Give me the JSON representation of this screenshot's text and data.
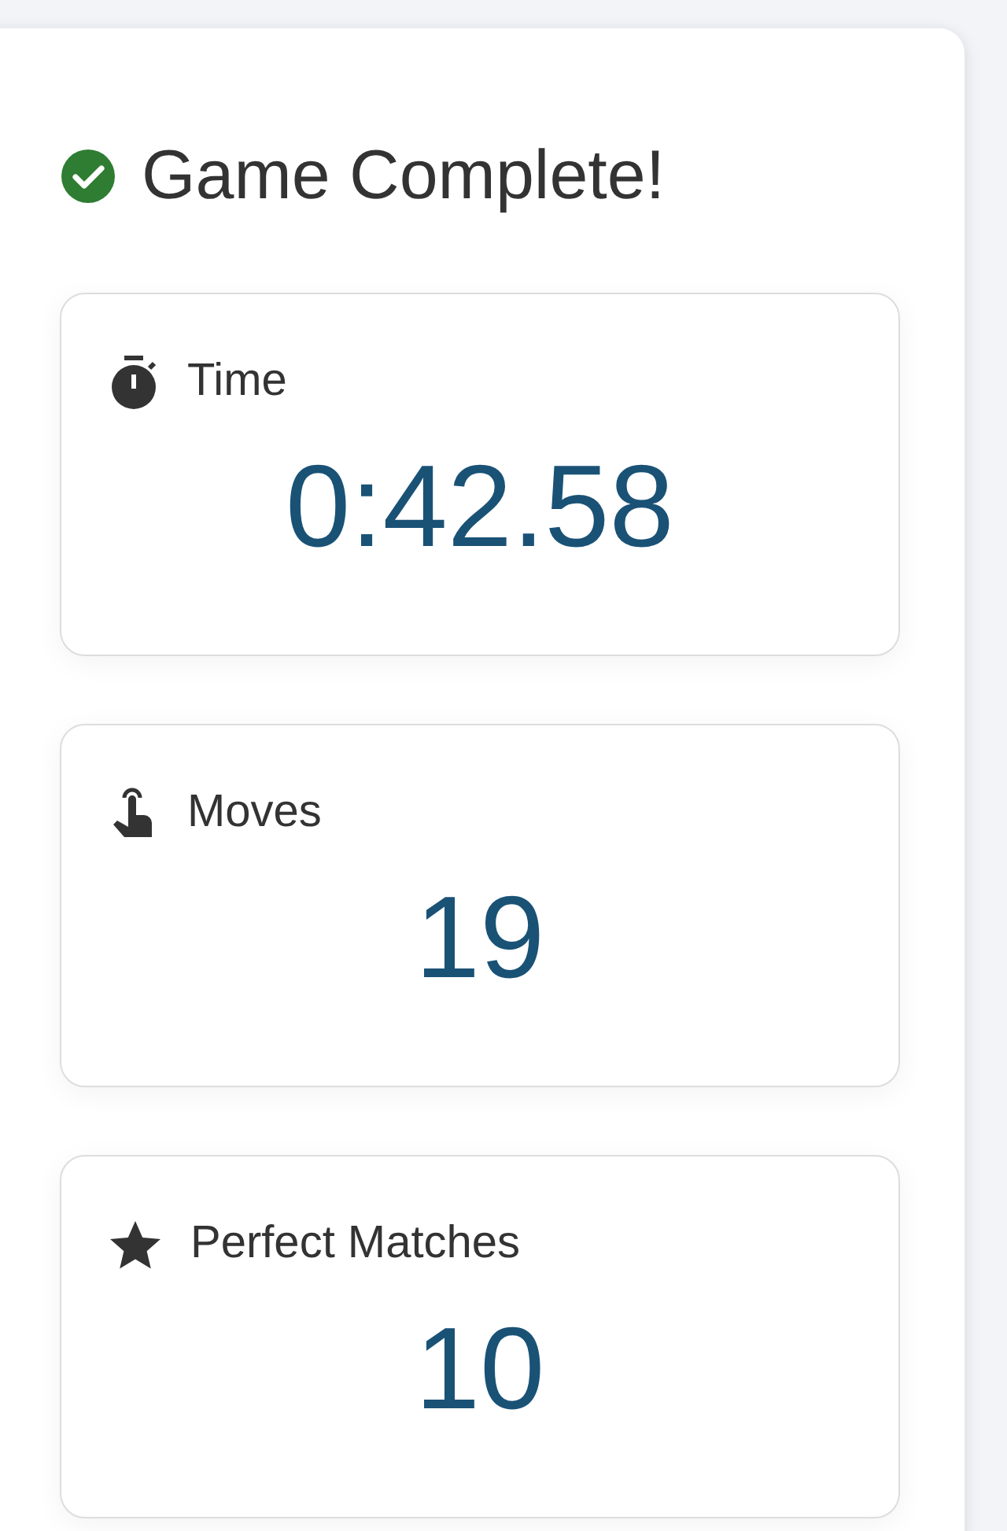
{
  "title": "Game Complete!",
  "stats": [
    {
      "kind": "time",
      "label": "Time",
      "value": "0:42.58"
    },
    {
      "kind": "moves",
      "label": "Moves",
      "value": "19"
    },
    {
      "kind": "perfect",
      "label": "Perfect Matches",
      "value": "10"
    }
  ]
}
